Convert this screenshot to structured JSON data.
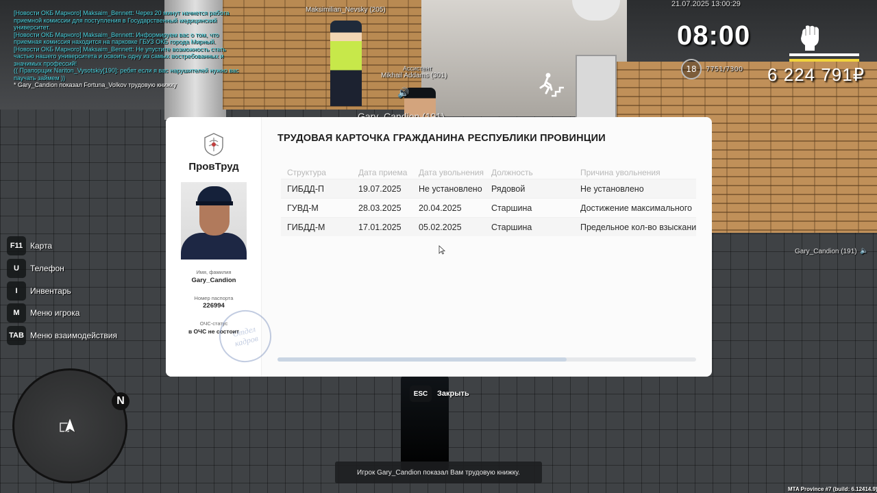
{
  "chat": [
    {
      "type": "news",
      "text": "[Новости ОКБ Марного] Maksaim_Bennett: Через 20 минут начнется работа приемной комиссии для поступления в Государственный медицинский университет."
    },
    {
      "type": "news",
      "text": "[Новости ОКБ Марного] Maksaim_Bennett: Информируем вас о том, что приемная комиссия находится на парковке ГБУЗ ОКБ города Мирный."
    },
    {
      "type": "news",
      "text": "[Новости ОКБ Марного] Maksaim_Bennett: Не упустите возможность стать частью нашего университета и освоить одну из самых востребованных и значимых профессий!"
    },
    {
      "type": "news",
      "text": "(( Прапорщик Nariton_Vysotskiy[190]: ребят если я вас нарушителей нужно вас паучать займем ))"
    },
    {
      "type": "white",
      "text": "* Gary_Candion показал Fortuna_Volkov трудовую книжку"
    }
  ],
  "tags": {
    "npc1": "Maksimilian_Nevsky (205)",
    "npc2_sub": "Ассистент",
    "npc2": "Mikhail Addams (301)",
    "npc3": "Gary_Candion (191)",
    "side": "Gary_Candion (191)"
  },
  "hud": {
    "date": "21.07.2025 13:00:29",
    "time": "08:00",
    "level": "18",
    "xp": "7751/7300",
    "money": "6 224 791₽",
    "hunger_fraction": 1.0
  },
  "hotkeys": [
    {
      "key": "F11",
      "label": "Карта"
    },
    {
      "key": "U",
      "label": "Телефон"
    },
    {
      "key": "I",
      "label": "Инвентарь"
    },
    {
      "key": "M",
      "label": "Меню игрока"
    },
    {
      "key": "TAB",
      "label": "Меню взаимодействия"
    }
  ],
  "minimap": {
    "north": "N"
  },
  "card": {
    "org_name": "ПровТруд",
    "title": "ТРУДОВАЯ КАРТОЧКА ГРАЖДАНИНА РЕСПУБЛИКИ ПРОВИНЦИИ",
    "name_caption": "Имя, фамилия",
    "name_value": "Gary_Candion",
    "passport_caption": "Номер паспорта",
    "passport_value": "226994",
    "ochs_caption": "ОЧС-статус",
    "ochs_value": "в ОЧС не состоит",
    "stamp_line1": "Отдел",
    "stamp_line2": "кадров",
    "columns": [
      "Структура",
      "Дата приема",
      "Дата увольнения",
      "Должность",
      "Причина увольнения"
    ],
    "rows": [
      [
        "ГИБДД-П",
        "19.07.2025",
        "Не установлено",
        "Рядовой",
        "Не установлено"
      ],
      [
        "ГУВД-М",
        "28.03.2025",
        "20.04.2025",
        "Старшина",
        "Достижение максимального"
      ],
      [
        "ГИБДД-М",
        "17.01.2025",
        "05.02.2025",
        "Старшина",
        "Предельное кол-во взыскани"
      ]
    ],
    "scroll_fraction": 0.69
  },
  "close": {
    "key": "ESC",
    "label": "Закрыть"
  },
  "notification": "Игрок Gary_Candion показал Вам трудовую книжку.",
  "build": "MTA Province #7 (build: 6.12414.9)"
}
